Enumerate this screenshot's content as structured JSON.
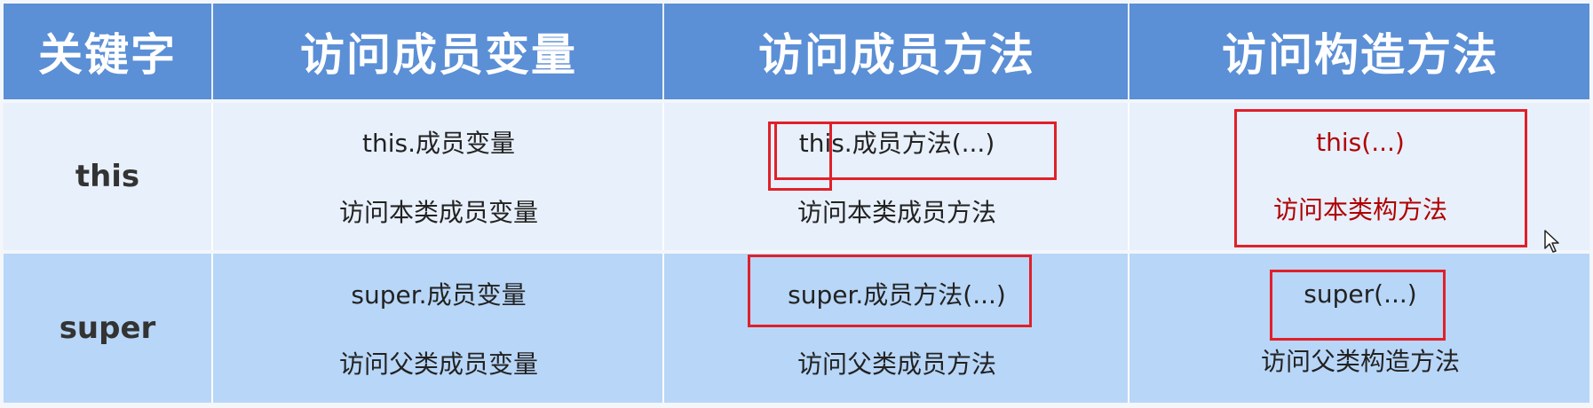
{
  "header": {
    "keyword": "关键字",
    "member_var": "访问成员变量",
    "member_method": "访问成员方法",
    "constructor": "访问构造方法"
  },
  "rows": [
    {
      "keyword": "this",
      "member_var": {
        "code": "this.成员变量",
        "desc": "访问本类成员变量"
      },
      "member_method": {
        "code": "this.成员方法(...)",
        "desc": "访问本类成员方法"
      },
      "constructor": {
        "code": "this(...)",
        "desc": "访问本类构方法"
      }
    },
    {
      "keyword": "super",
      "member_var": {
        "code": "super.成员变量",
        "desc": "访问父类成员变量"
      },
      "member_method": {
        "code": "super.成员方法(...)",
        "desc": "访问父类成员方法"
      },
      "constructor": {
        "code": "super(...)",
        "desc": "访问父类构造方法"
      }
    }
  ],
  "colors": {
    "header_bg": "#5b8fd6",
    "row_this_bg": "#e8f0fb",
    "row_super_bg": "#b8d6f7",
    "highlight_box": "#e0202a",
    "highlight_text": "#b00000"
  },
  "icons": {
    "cursor": "mouse-pointer-icon"
  }
}
